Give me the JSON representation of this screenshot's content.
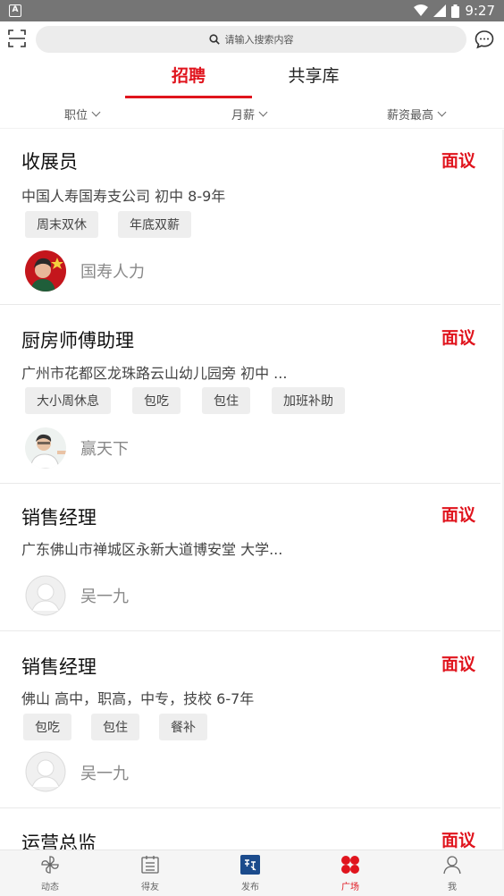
{
  "status_bar": {
    "time": "9:27",
    "notify_icon": "A"
  },
  "search": {
    "placeholder": "请输入搜索内容"
  },
  "tabs": [
    {
      "label": "招聘",
      "active": true
    },
    {
      "label": "共享库",
      "active": false
    }
  ],
  "filters": [
    {
      "label": "职位"
    },
    {
      "label": "月薪"
    },
    {
      "label": "薪资最高"
    }
  ],
  "jobs": [
    {
      "title": "收展员",
      "salary": "面议",
      "meta": "中国人寿国寿支公司   初中   8-9年",
      "tags": [
        "周末双休",
        "年底双薪"
      ],
      "poster": "国寿人力"
    },
    {
      "title": "厨房师傅助理",
      "salary": "面议",
      "meta": "广州市花都区龙珠路云山幼儿园旁   初中 ...",
      "tags": [
        "大小周休息",
        "包吃",
        "包住",
        "加班补助"
      ],
      "poster": "赢天下"
    },
    {
      "title": "销售经理",
      "salary": "面议",
      "meta": "广东佛山市禅城区永新大道博安堂   大学...",
      "tags": [],
      "poster": "吴一九"
    },
    {
      "title": "销售经理",
      "salary": "面议",
      "meta": "佛山   高中，职高，中专，技校   6-7年",
      "tags": [
        "包吃",
        "包住",
        "餐补"
      ],
      "poster": "吴一九"
    },
    {
      "title": "运营总监",
      "salary": "面议"
    }
  ],
  "bottom_nav": [
    {
      "label": "动态",
      "icon": "pinwheel-icon",
      "active": false
    },
    {
      "label": "得友",
      "icon": "calendar-list-icon",
      "active": false
    },
    {
      "label": "发布",
      "icon": "publish-logo-icon",
      "active": false
    },
    {
      "label": "广场",
      "icon": "four-dots-icon",
      "active": true
    },
    {
      "label": "我",
      "icon": "person-icon",
      "active": false
    }
  ],
  "colors": {
    "accent": "#e0141d",
    "status_bar": "#757575",
    "tag_bg": "#eeeeee"
  }
}
